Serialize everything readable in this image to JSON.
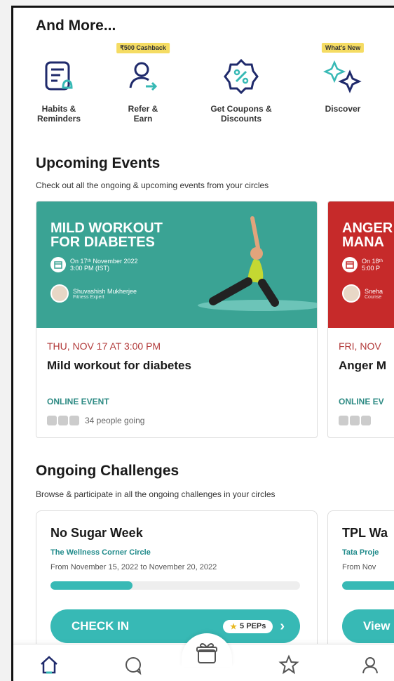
{
  "more": {
    "title": "And More...",
    "items": [
      {
        "label_line1": "Habits &",
        "label_line2": "Reminders",
        "badge": "",
        "icon": "habits-reminders-icon"
      },
      {
        "label_line1": "Refer &",
        "label_line2": "Earn",
        "badge": "₹500 Cashback",
        "icon": "refer-earn-icon"
      },
      {
        "label_line1": "Get Coupons &",
        "label_line2": "Discounts",
        "badge": "",
        "icon": "coupon-icon"
      },
      {
        "label_line1": "Discover",
        "label_line2": "",
        "badge": "What's New",
        "icon": "sparkle-icon"
      }
    ]
  },
  "events": {
    "title": "Upcoming Events",
    "subtitle": "Check out all the ongoing & upcoming events from your circles",
    "cards": [
      {
        "banner_line1": "MILD WORKOUT",
        "banner_line2": "FOR DIABETES",
        "banner_date_line1": "On 17ᵗʰ November 2022",
        "banner_date_line2": "3:00 PM (IST)",
        "host_name": "Shuvashish Mukherjee",
        "host_role": "Fitness Expert",
        "date": "THU, NOV 17 AT 3:00 PM",
        "name": "Mild workout for diabetes",
        "type": "ONLINE EVENT",
        "going": "34 people going",
        "color": "#3aa394"
      },
      {
        "banner_line1": "ANGER",
        "banner_line2": "MANA",
        "banner_date_line1": "On 18ᵗʰ",
        "banner_date_line2": "5:00 P",
        "host_name": "Sneha",
        "host_role": "Counse",
        "date": "FRI, NOV",
        "name": "Anger M",
        "type": "ONLINE EV",
        "going": "",
        "color": "#c62a2a"
      }
    ]
  },
  "challenges": {
    "title": "Ongoing Challenges",
    "subtitle": "Browse & participate in all the ongoing challenges in your circles",
    "cards": [
      {
        "name": "No Sugar Week",
        "circle": "The Wellness Corner Circle",
        "range": "From November 15, 2022 to November 20, 2022",
        "progress": 0.33,
        "button": "CHECK IN",
        "reward": "5 PEPs"
      },
      {
        "name": "TPL Wa",
        "circle": "Tata Proje",
        "range": "From Nov",
        "progress": 0.5,
        "button": "View",
        "reward": ""
      }
    ]
  },
  "nav": {
    "items": [
      "home-icon",
      "chat-icon",
      "gift-icon",
      "star-icon",
      "profile-icon"
    ]
  },
  "colors": {
    "accent": "#37b9b5",
    "event_green": "#3aa394",
    "event_red": "#c62a2a"
  }
}
